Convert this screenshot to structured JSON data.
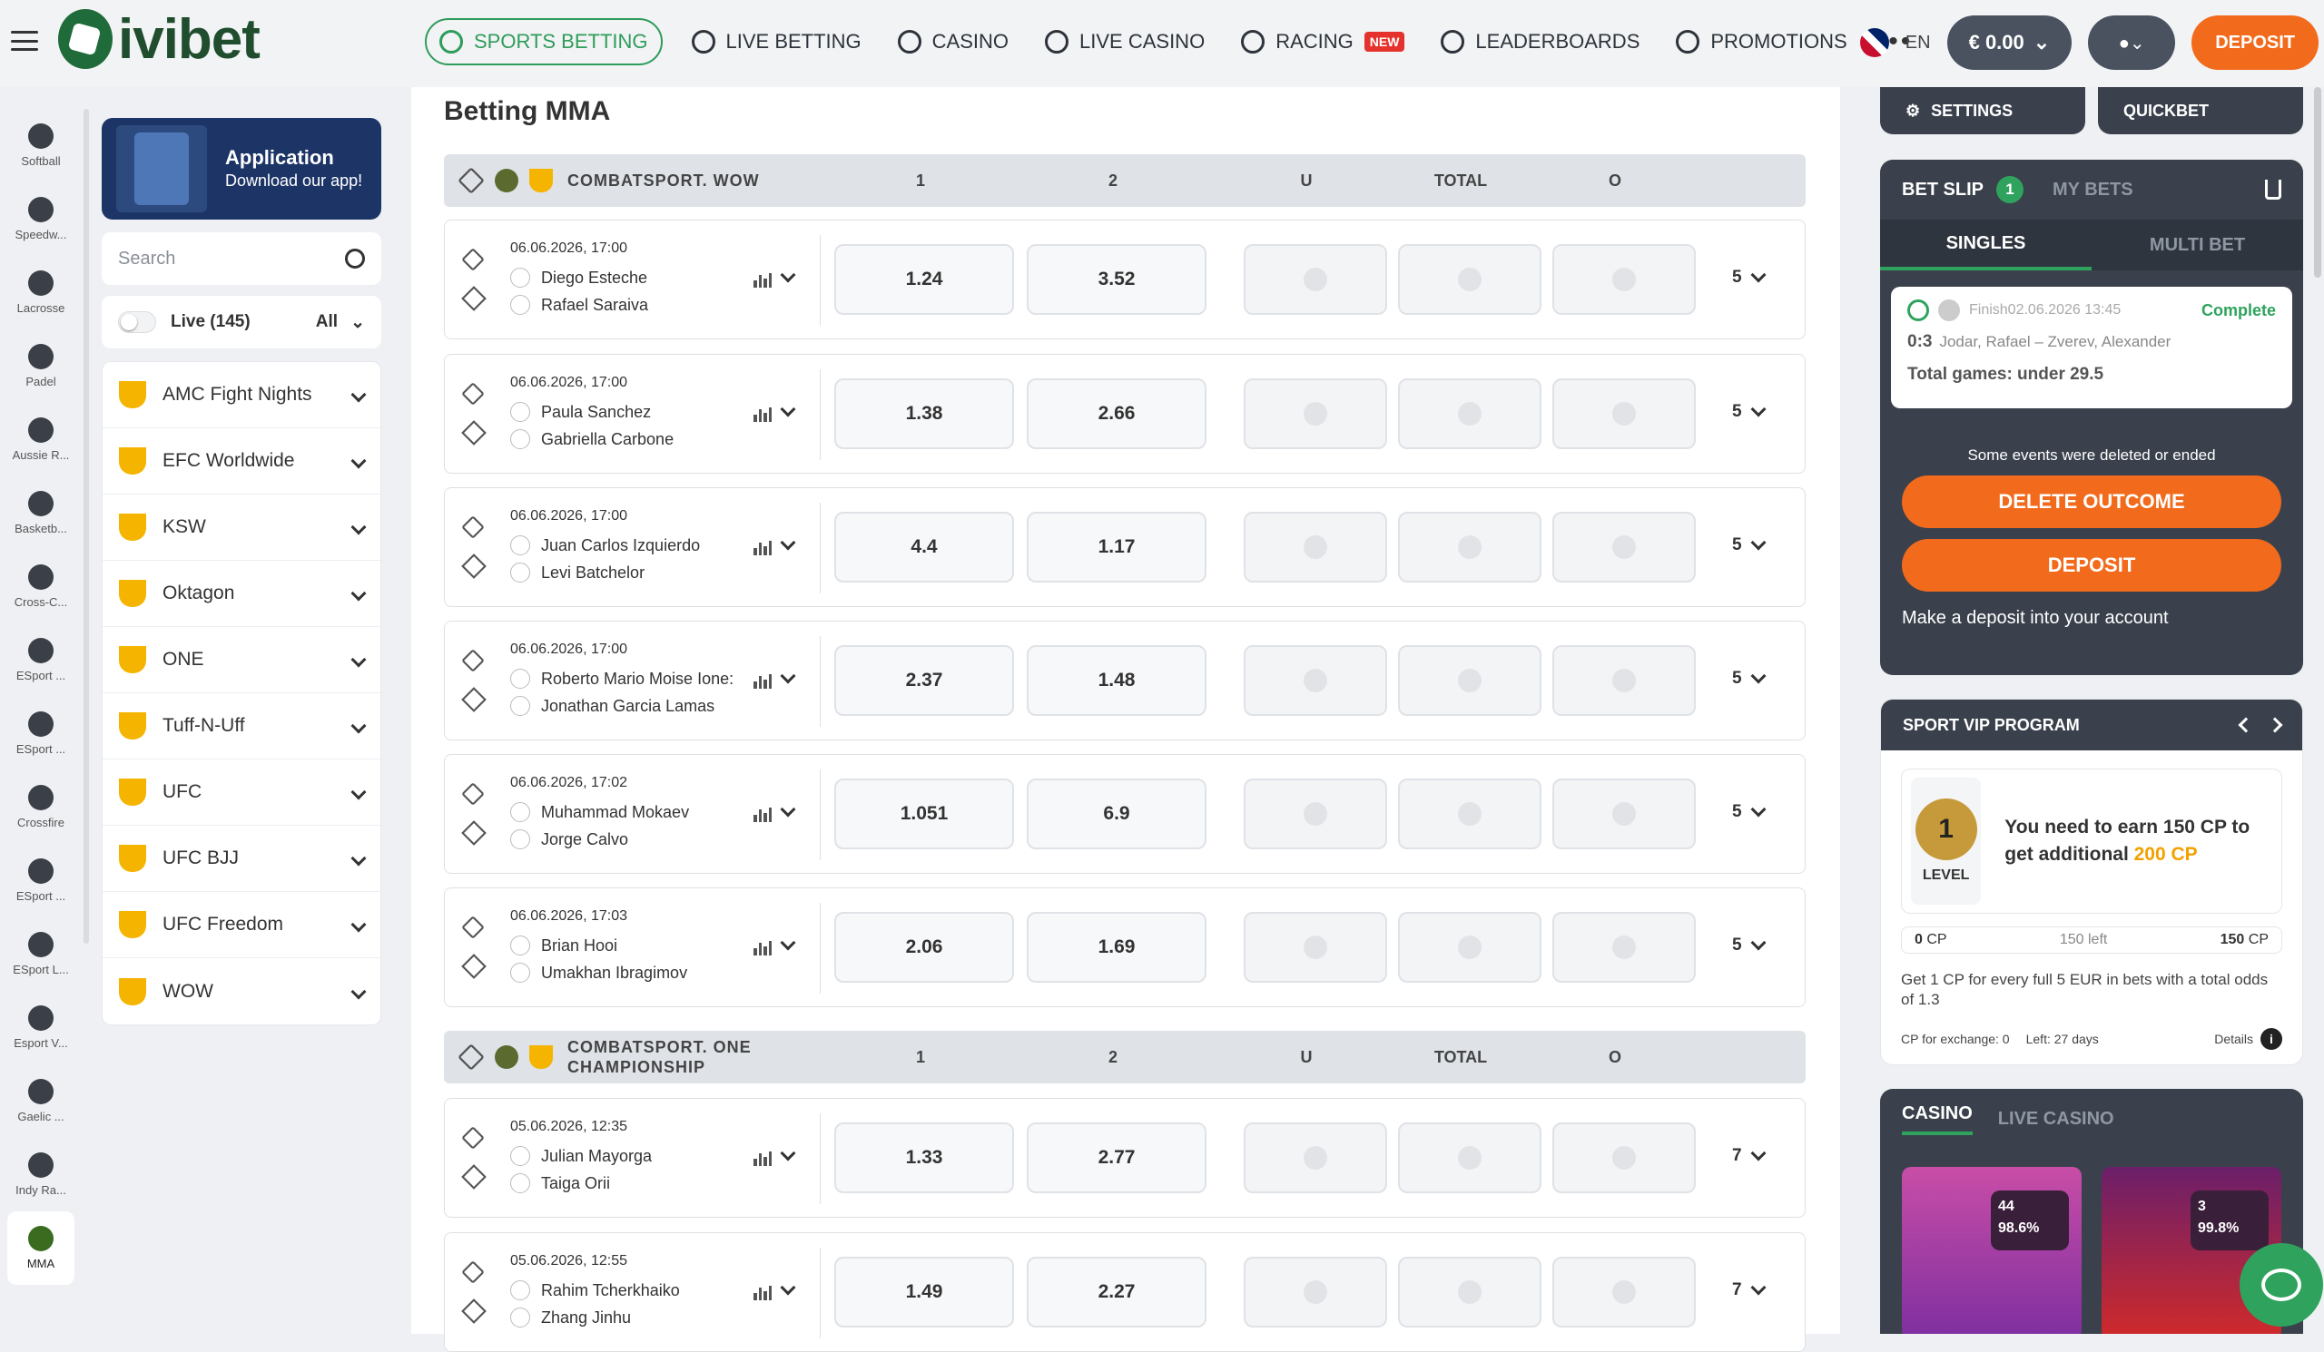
{
  "brand": {
    "name": "ivibet"
  },
  "nav": [
    {
      "label": "SPORTS BETTING",
      "active": true
    },
    {
      "label": "LIVE BETTING"
    },
    {
      "label": "CASINO"
    },
    {
      "label": "LIVE CASINO"
    },
    {
      "label": "RACING",
      "badge": "NEW"
    },
    {
      "label": "LEADERBOARDS"
    },
    {
      "label": "PROMOTIONS"
    }
  ],
  "header": {
    "lang": "EN",
    "balance": "€ 0.00",
    "deposit": "DEPOSIT"
  },
  "sports": [
    "Softball",
    "Speedw...",
    "Lacrosse",
    "Padel",
    "Aussie R...",
    "Basketb...",
    "Cross-C...",
    "ESport ...",
    "ESport ...",
    "Crossfire",
    "ESport ...",
    "ESport L...",
    "Esport V...",
    "Gaelic ...",
    "Indy Ra...",
    "MMA"
  ],
  "left": {
    "app_title": "Application",
    "app_sub": "Download our app!",
    "search_placeholder": "Search",
    "live_label": "Live (145)",
    "live_filter": "All",
    "tournaments": [
      "AMC Fight Nights",
      "EFC Worldwide",
      "KSW",
      "Oktagon",
      "ONE",
      "Tuff-N-Uff",
      "UFC",
      "UFC BJJ",
      "UFC Freedom",
      "WOW"
    ]
  },
  "page_title": "Betting MMA",
  "columns": {
    "c1": "1",
    "c2": "2",
    "cu": "U",
    "ctotal": "TOTAL",
    "co": "O"
  },
  "groups": [
    {
      "name": "COMBATSPORT. WOW"
    },
    {
      "name": "COMBATSPORT. ONE CHAMPIONSHIP"
    }
  ],
  "matches": [
    {
      "datetime": "06.06.2026, 17:00",
      "p1": "Diego Esteche",
      "p2": "Rafael Saraiva",
      "o1": "1.24",
      "o2": "3.52",
      "more": "5"
    },
    {
      "datetime": "06.06.2026, 17:00",
      "p1": "Paula Sanchez",
      "p2": "Gabriella Carbone",
      "o1": "1.38",
      "o2": "2.66",
      "more": "5"
    },
    {
      "datetime": "06.06.2026, 17:00",
      "p1": "Juan Carlos Izquierdo",
      "p2": "Levi Batchelor",
      "o1": "4.4",
      "o2": "1.17",
      "more": "5"
    },
    {
      "datetime": "06.06.2026, 17:00",
      "p1": "Roberto Mario Moise Ione:",
      "p2": "Jonathan Garcia Lamas",
      "o1": "2.37",
      "o2": "1.48",
      "more": "5"
    },
    {
      "datetime": "06.06.2026, 17:02",
      "p1": "Muhammad Mokaev",
      "p2": "Jorge Calvo",
      "o1": "1.051",
      "o2": "6.9",
      "more": "5"
    },
    {
      "datetime": "06.06.2026, 17:03",
      "p1": "Brian Hooi",
      "p2": "Umakhan Ibragimov",
      "o1": "2.06",
      "o2": "1.69",
      "more": "5"
    },
    {
      "datetime": "05.06.2026, 12:35",
      "p1": "Julian Mayorga",
      "p2": "Taiga Orii",
      "o1": "1.33",
      "o2": "2.77",
      "more": "7"
    },
    {
      "datetime": "05.06.2026, 12:55",
      "p1": "Rahim Tcherkhaiko",
      "p2": "Zhang Jinhu",
      "o1": "1.49",
      "o2": "2.27",
      "more": "7"
    }
  ],
  "rightTabs": {
    "settings": "SETTINGS",
    "quickbet": "QUICKBET"
  },
  "betslip": {
    "title": "BET SLIP",
    "count": "1",
    "mybets": "MY BETS",
    "singles": "SINGLES",
    "multi": "MULTI BET",
    "status_line": "Finish02.06.2026 13:45",
    "complete": "Complete",
    "score": "0:3",
    "event": "Jodar, Rafael – Zverev, Alexander",
    "market": "Total games: under 29.5",
    "note": "Some events were deleted or ended",
    "delete": "DELETE OUTCOME",
    "deposit": "DEPOSIT",
    "deposit_note": "Make a deposit into your account"
  },
  "vip": {
    "title": "SPORT VIP PROGRAM",
    "level_num": "1",
    "level_word": "LEVEL",
    "msg_a": "You need to earn 150 CP to get additional",
    "msg_b": "200 CP",
    "p_left": "0",
    "p_mid": "150 left",
    "p_right": "150",
    "cp": "CP",
    "text": "Get 1 CP for every full 5 EUR in bets with a total odds of 1.3",
    "exchange": "CP for exchange: 0",
    "left": "Left:  27 days",
    "details": "Details"
  },
  "casino": {
    "tab1": "CASINO",
    "tab2": "LIVE CASINO",
    "g1_a": "44",
    "g1_b": "98.6%",
    "g2_a": "3",
    "g2_b": "99.8%"
  }
}
